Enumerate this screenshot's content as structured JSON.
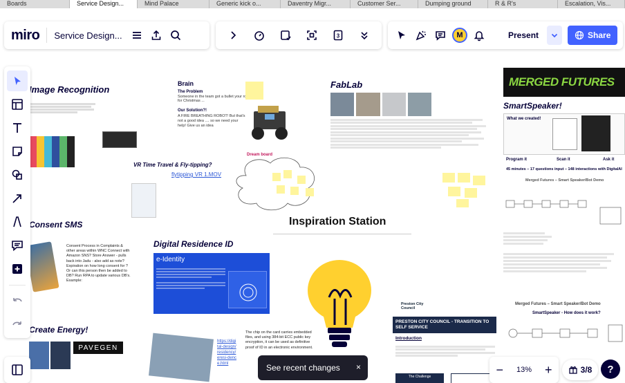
{
  "browser_tabs": [
    "Boards",
    "Service Design...",
    "Mind Palace",
    "Generic kick o...",
    "Daventry Migr...",
    "Customer Ser...",
    "Dumping ground",
    "R & R's",
    "Escalation, Vis..."
  ],
  "topbar": {
    "logo": "miro",
    "board_title": "Service Design...",
    "present_label": "Present",
    "share_label": "Share",
    "avatar_initial": "M",
    "accent_color": "#4262ff"
  },
  "board": {
    "sections": {
      "image_recognition": "Image Recognition",
      "brain": "Brain",
      "brain_problem": "The Problem",
      "brain_problem_text": "Someone in the team got a bullet your robot for Christmas ...",
      "brain_solution": "Our Solution?!",
      "brain_solution_text": "A FIRE BREATHING ROBOT! But that's not a good idea .... so we need your help! Give us an idea",
      "fablab": "FabLab",
      "smart_speaker": "SmartSpeaker!",
      "merged_futures": "MERGED FUTURES",
      "what_we_created": "What we created!",
      "program_it": "Program it",
      "scan_it": "Scan it",
      "ask_it": "Ask it",
      "stats": "45 minutes – 17 questions input – 148 interactions with DigitalAI",
      "mf_smart_speaker_demo": "Merged Futures – Smart Speaker/Bot Demo",
      "smart_speaker_how": "SmartSpeaker - How does it work?",
      "vr_time_travel": "VR Time Travel & Fly-tipping?",
      "vr_link": "flytipping VR 1.MOV",
      "dream_board": "Dream board",
      "consent_sms": "Consent SMS",
      "consent_text": "Consent Process in Complaints & other areas within WNC Connect with Amazon SNS? Store Answer - pulls back into Jadu - also add as note? Expiration on how long consent for ? Or can this person then be added to DB? Run RPA to update various DB's. Example:",
      "inspiration_station": "Inspiration Station",
      "digital_residence_id": "Digital Residence ID",
      "eidentity": "e-Identity",
      "create_energy": "Create Energy!",
      "pavegen": "PAVEGEN",
      "chip_text": "The chip on the card carries embedded files, and using 384-bit ECC public key encryption, it can be used as definitive proof of ID in an electronic environment.",
      "chip_link": "https://digital-design/residency/eresi-dence.html",
      "preston_logo": "Preston City Council",
      "preston_title": "PRESTON CITY COUNCIL - TRANSITION TO SELF SERVICE",
      "introduction": "Introduction",
      "challenge": "The Challenge"
    }
  },
  "toast": {
    "text": "See recent changes",
    "close": "×"
  },
  "zoom": {
    "minus": "−",
    "level": "13%",
    "plus": "+"
  },
  "pages": "3/8",
  "help": "?"
}
